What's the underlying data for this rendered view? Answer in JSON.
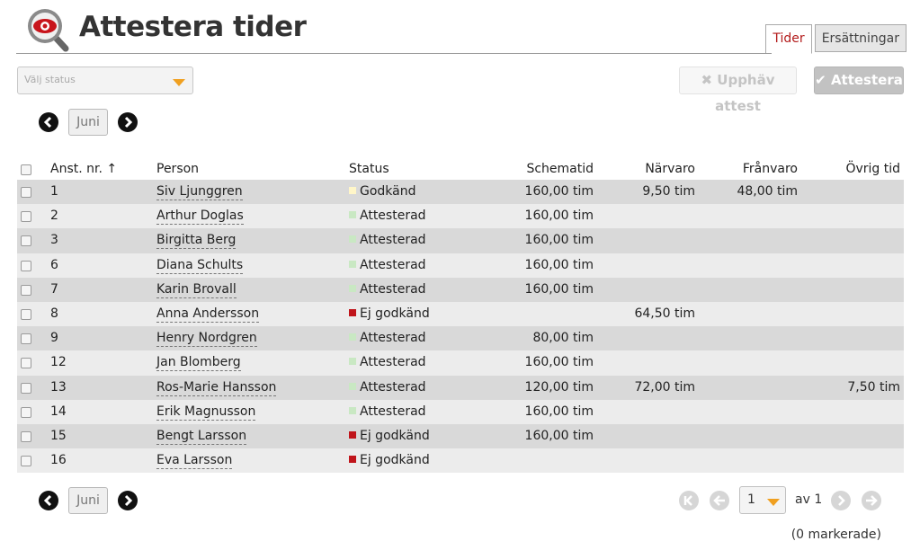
{
  "header": {
    "title": "Attestera tider",
    "tabs": [
      {
        "label": "Tider",
        "active": true
      },
      {
        "label": "Ersättningar",
        "active": false
      }
    ]
  },
  "toolbar": {
    "status_placeholder": "Välj status",
    "unattest_label": "Upphäv attest",
    "attest_label": "Attestera"
  },
  "month": {
    "label": "Juni"
  },
  "columns": {
    "number": "Anst. nr. ↑",
    "person": "Person",
    "status": "Status",
    "schedule": "Schematid",
    "presence": "Närvaro",
    "absence": "Frånvaro",
    "other": "Övrig tid"
  },
  "status_colors": {
    "Godkänd": "#fff6c8",
    "Attesterad": "#c9e8c3",
    "Ej godkänd": "#c0151b"
  },
  "rows": [
    {
      "number": "1",
      "person": "Siv Ljunggren",
      "status": "Godkänd",
      "schedule": "160,00 tim",
      "presence": "9,50 tim",
      "absence": "48,00 tim",
      "other": ""
    },
    {
      "number": "2",
      "person": "Arthur Doglas",
      "status": "Attesterad",
      "schedule": "160,00 tim",
      "presence": "",
      "absence": "",
      "other": ""
    },
    {
      "number": "3",
      "person": "Birgitta Berg",
      "status": "Attesterad",
      "schedule": "160,00 tim",
      "presence": "",
      "absence": "",
      "other": ""
    },
    {
      "number": "6",
      "person": "Diana Schults",
      "status": "Attesterad",
      "schedule": "160,00 tim",
      "presence": "",
      "absence": "",
      "other": ""
    },
    {
      "number": "7",
      "person": "Karin Brovall",
      "status": "Attesterad",
      "schedule": "160,00 tim",
      "presence": "",
      "absence": "",
      "other": ""
    },
    {
      "number": "8",
      "person": "Anna Andersson",
      "status": "Ej godkänd",
      "schedule": "",
      "presence": "64,50 tim",
      "absence": "",
      "other": ""
    },
    {
      "number": "9",
      "person": "Henry Nordgren",
      "status": "Attesterad",
      "schedule": "80,00 tim",
      "presence": "",
      "absence": "",
      "other": ""
    },
    {
      "number": "12",
      "person": "Jan Blomberg",
      "status": "Attesterad",
      "schedule": "160,00 tim",
      "presence": "",
      "absence": "",
      "other": ""
    },
    {
      "number": "13",
      "person": "Ros-Marie Hansson",
      "status": "Attesterad",
      "schedule": "120,00 tim",
      "presence": "72,00 tim",
      "absence": "",
      "other": "7,50 tim"
    },
    {
      "number": "14",
      "person": "Erik Magnusson",
      "status": "Attesterad",
      "schedule": "160,00 tim",
      "presence": "",
      "absence": "",
      "other": ""
    },
    {
      "number": "15",
      "person": "Bengt Larsson",
      "status": "Ej godkänd",
      "schedule": "160,00 tim",
      "presence": "",
      "absence": "",
      "other": ""
    },
    {
      "number": "16",
      "person": "Eva Larsson",
      "status": "Ej godkänd",
      "schedule": "",
      "presence": "",
      "absence": "",
      "other": ""
    }
  ],
  "pager": {
    "page": "1",
    "of_label": "av 1",
    "marked_label": "(0 markerade)"
  }
}
